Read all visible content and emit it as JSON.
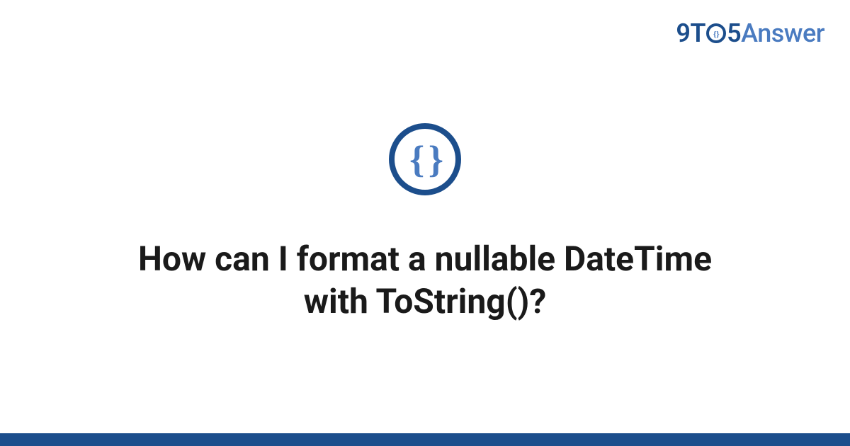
{
  "brand": {
    "part1": "9",
    "part2": "T",
    "part3": "5",
    "part4": "Answer"
  },
  "logo": {
    "braces": "{ }"
  },
  "title": "How can I format a nullable DateTime with ToString()?",
  "colors": {
    "primary": "#1c4e8c",
    "secondary": "#4a7bc0"
  }
}
